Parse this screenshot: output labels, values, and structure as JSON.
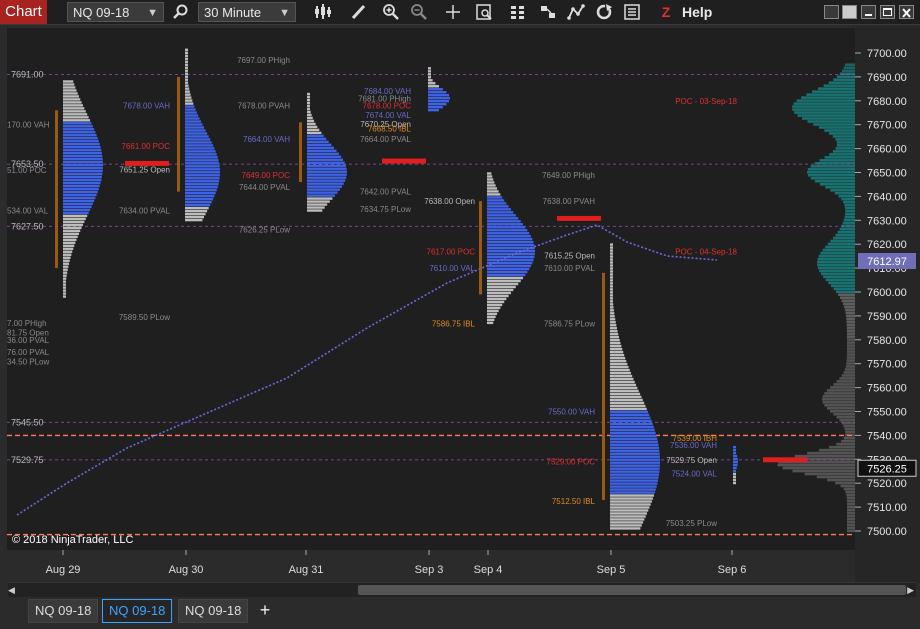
{
  "toolbar": {
    "chart_label": "Chart",
    "instrument": "NQ 09-18",
    "interval": "30 Minute",
    "help": "Help",
    "icons": [
      "magnifier-icon",
      "bars-type-icon",
      "pencil-icon",
      "zoom-in-icon",
      "zoom-out-icon",
      "crosshair-icon",
      "data-box-icon",
      "indicators-icon",
      "strategies-icon",
      "drawing-tools-icon",
      "reload-icon",
      "properties-icon",
      "zone-icon"
    ]
  },
  "window_buttons": [
    "tile-icon",
    "restore-icon",
    "minimize-icon",
    "maximize-icon",
    "close-icon"
  ],
  "copyright": "© 2018 NinjaTrader, LLC",
  "tabs": [
    {
      "label": "NQ 09-18",
      "active": false
    },
    {
      "label": "NQ 09-18",
      "active": true
    },
    {
      "label": "NQ 09-18",
      "active": false
    }
  ],
  "add_tab": "+",
  "chart_data": {
    "type": "market-profile",
    "y_axis": {
      "min": 7500,
      "max": 7700,
      "step": 10,
      "ticks": [
        "7700.00",
        "7690.00",
        "7680.00",
        "7670.00",
        "7660.00",
        "7650.00",
        "7640.00",
        "7630.00",
        "7620.00",
        "7610.00",
        "7600.00",
        "7590.00",
        "7580.00",
        "7570.00",
        "7560.00",
        "7550.00",
        "7540.00",
        "7530.00",
        "7520.00",
        "7510.00",
        "7500.00"
      ]
    },
    "current_price": "7526.25",
    "marker_price": "7612.97",
    "x_labels": [
      "Aug 29",
      "Aug 30",
      "Aug 31",
      "Sep 3",
      "Sep 4",
      "Sep 5",
      "Sep 6"
    ],
    "left_labels": [
      "7691.00",
      "7653.50",
      "7627.50",
      "7545.50",
      "7529.75"
    ],
    "level_labels": [
      {
        "text": "7697.00 PHigh",
        "price": 7697,
        "color": "#8a8a8a"
      },
      {
        "text": "7678.00 VAH",
        "price": 7678,
        "color": "#6a6ac8"
      },
      {
        "text": "7678.00 PVAH",
        "price": 7678,
        "color": "#8a8a8a"
      },
      {
        "text": "7661.00 POC",
        "price": 7661,
        "color": "#e03030"
      },
      {
        "text": "7651.25 Open",
        "price": 7651.25,
        "color": "#bbbbbb"
      },
      {
        "text": "7634.00 PVAL",
        "price": 7634,
        "color": "#8a8a8a"
      },
      {
        "text": "7626.25 PLow",
        "price": 7626.25,
        "color": "#8a8a8a"
      },
      {
        "text": "7589.50 PLow",
        "price": 7589.5,
        "color": "#8a8a8a"
      },
      {
        "text": "7664.00 VAH",
        "price": 7664,
        "color": "#6a6ac8"
      },
      {
        "text": "7649.00 POC",
        "price": 7649,
        "color": "#e03030"
      },
      {
        "text": "7644.00 PVAL",
        "price": 7644,
        "color": "#8a8a8a"
      },
      {
        "text": "7642.00 PVAL",
        "price": 7642,
        "color": "#8a8a8a"
      },
      {
        "text": "7634.75 PLow",
        "price": 7634.75,
        "color": "#8a8a8a"
      },
      {
        "text": "7684.00 VAH",
        "price": 7684,
        "color": "#6a6ac8"
      },
      {
        "text": "7681.00 PHigh",
        "price": 7681,
        "color": "#8a8a8a"
      },
      {
        "text": "7678.00 POC",
        "price": 7678,
        "color": "#e03030"
      },
      {
        "text": "7674.00 VAL",
        "price": 7674,
        "color": "#6a6ac8"
      },
      {
        "text": "7670.25 Open",
        "price": 7670.25,
        "color": "#bbbbbb"
      },
      {
        "text": "7668.50 IBL",
        "price": 7668.5,
        "color": "#e08a20"
      },
      {
        "text": "7664.00 PVAL",
        "price": 7664,
        "color": "#8a8a8a"
      },
      {
        "text": "7649.00 PHigh",
        "price": 7649,
        "color": "#8a8a8a"
      },
      {
        "text": "7638.00 Open",
        "price": 7638,
        "color": "#bbbbbb"
      },
      {
        "text": "7638.00 PVAH",
        "price": 7638,
        "color": "#8a8a8a"
      },
      {
        "text": "7617.00 POC",
        "price": 7617,
        "color": "#e03030"
      },
      {
        "text": "7615.25 Open",
        "price": 7615.25,
        "color": "#bbbbbb"
      },
      {
        "text": "7610.00 VAL",
        "price": 7610,
        "color": "#6a6ac8"
      },
      {
        "text": "7610.00 PVAL",
        "price": 7610,
        "color": "#8a8a8a"
      },
      {
        "text": "7586.75 IBL",
        "price": 7586.75,
        "color": "#e08a20"
      },
      {
        "text": "7586.75 PLow",
        "price": 7586.75,
        "color": "#8a8a8a"
      },
      {
        "text": "7550.00 VAH",
        "price": 7550,
        "color": "#6a6ac8"
      },
      {
        "text": "7529.00 POC",
        "price": 7529,
        "color": "#e03030"
      },
      {
        "text": "7512.50 IBL",
        "price": 7512.5,
        "color": "#e08a20"
      },
      {
        "text": "7539.00 IBH",
        "price": 7539,
        "color": "#e08a20"
      },
      {
        "text": "7536.00 VAH",
        "price": 7536,
        "color": "#6a6ac8"
      },
      {
        "text": "7529.75 Open",
        "price": 7529.75,
        "color": "#bbbbbb"
      },
      {
        "text": "7524.00 VAL",
        "price": 7524,
        "color": "#6a6ac8"
      },
      {
        "text": "7503.25 PLow",
        "price": 7503.25,
        "color": "#8a8a8a"
      },
      {
        "text": "POC - 03-Sep-18",
        "price": 7680,
        "color": "#e03030"
      },
      {
        "text": "POC - 04-Sep-18",
        "price": 7617,
        "color": "#e03030"
      }
    ],
    "partial_left_labels": [
      "170.00 VAH",
      "51.00 POC",
      "534.00 VAL",
      "7.00 PHigh",
      "81.75 Open",
      "36.00 PVAL",
      "76.00 PVAL",
      "34.50 PLow"
    ],
    "colors": {
      "value_area": "#3f63e6",
      "outside": "#bdbdbd",
      "poc": "#e01e1e",
      "vwap": "#6a6ae0",
      "ib": "#9a5a14",
      "volume_profile": "#19807f",
      "dashed_orange": "#ff7a59",
      "dashed_purple": "#9b4fb0"
    }
  }
}
